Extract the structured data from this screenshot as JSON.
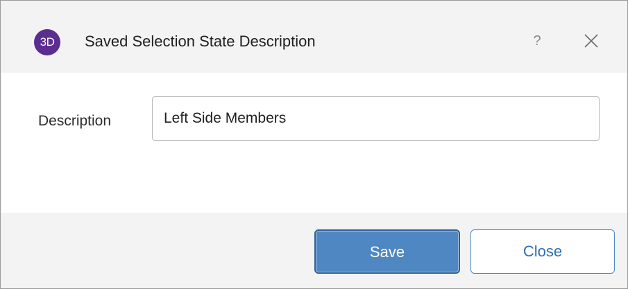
{
  "window": {
    "app_icon_text": "3D",
    "title": "Saved Selection State Description",
    "help_label": "?",
    "icons": {
      "app": "app-logo-icon",
      "close": "close-icon"
    }
  },
  "form": {
    "description_label": "Description",
    "description_value": "Left Side Members"
  },
  "footer": {
    "save_label": "Save",
    "close_label": "Close"
  },
  "colors": {
    "accent": "#4f87c2",
    "app_icon": "#5b2d91",
    "titlebar_bg": "#f3f3f3"
  }
}
